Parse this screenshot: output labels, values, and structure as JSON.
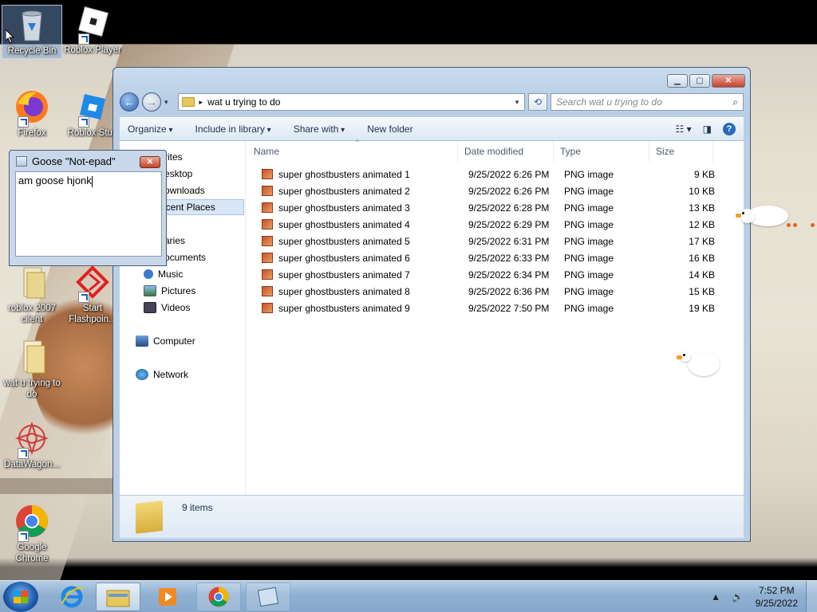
{
  "desktop": {
    "icons": [
      {
        "label": "Recycle Bin",
        "icon": "recycle-bin-icon"
      },
      {
        "label": "Roblox Player",
        "icon": "roblox-icon"
      },
      {
        "label": "Firefox",
        "icon": "firefox-icon"
      },
      {
        "label": "Roblox Stud",
        "icon": "roblox-studio-icon"
      },
      {
        "label": "roblox 2007 cilent",
        "icon": "folder-icon"
      },
      {
        "label": "Start Flashpoin...",
        "icon": "flashpoint-icon"
      },
      {
        "label": "wat u trying to do",
        "icon": "folder-icon"
      },
      {
        "label": "DataWagon...",
        "icon": "datawagon-icon"
      },
      {
        "label": "Google Chrome",
        "icon": "chrome-icon"
      }
    ]
  },
  "notepad": {
    "title": "Goose \"Not-epad\"",
    "close": "✕",
    "text": "am goose hjonk"
  },
  "explorer": {
    "address": "wat u trying to do",
    "search_placeholder": "Search wat u trying to do",
    "toolbar": {
      "organize": "Organize",
      "include": "Include in library",
      "share": "Share with",
      "new_folder": "New folder"
    },
    "nav": {
      "favorites": "rites",
      "desktop": "esktop",
      "downloads": "ownloads",
      "recent": "ecent Places",
      "libraries": "aries",
      "documents": "ocuments",
      "music": "Music",
      "pictures": "Pictures",
      "videos": "Videos",
      "computer": "Computer",
      "network": "Network"
    },
    "columns": {
      "name": "Name",
      "date": "Date modified",
      "type": "Type",
      "size": "Size"
    },
    "files": [
      {
        "name": "super ghostbusters animated 1",
        "date": "9/25/2022 6:26 PM",
        "type": "PNG image",
        "size": "9 KB"
      },
      {
        "name": "super ghostbusters animated 2",
        "date": "9/25/2022 6:26 PM",
        "type": "PNG image",
        "size": "10 KB"
      },
      {
        "name": "super ghostbusters animated 3",
        "date": "9/25/2022 6:28 PM",
        "type": "PNG image",
        "size": "13 KB"
      },
      {
        "name": "super ghostbusters animated 4",
        "date": "9/25/2022 6:29 PM",
        "type": "PNG image",
        "size": "12 KB"
      },
      {
        "name": "super ghostbusters animated 5",
        "date": "9/25/2022 6:31 PM",
        "type": "PNG image",
        "size": "17 KB"
      },
      {
        "name": "super ghostbusters animated 6",
        "date": "9/25/2022 6:33 PM",
        "type": "PNG image",
        "size": "16 KB"
      },
      {
        "name": "super ghostbusters animated 7",
        "date": "9/25/2022 6:34 PM",
        "type": "PNG image",
        "size": "14 KB"
      },
      {
        "name": "super ghostbusters animated 8",
        "date": "9/25/2022 6:36 PM",
        "type": "PNG image",
        "size": "15 KB"
      },
      {
        "name": "super ghostbusters animated 9",
        "date": "9/25/2022 7:50 PM",
        "type": "PNG image",
        "size": "19 KB"
      }
    ],
    "status": "9 items"
  },
  "taskbar": {
    "time": "7:52 PM",
    "date": "9/25/2022",
    "apps": [
      "internet-explorer-icon",
      "windows-explorer-icon",
      "media-player-icon",
      "chrome-icon",
      "notepad-icon"
    ]
  }
}
